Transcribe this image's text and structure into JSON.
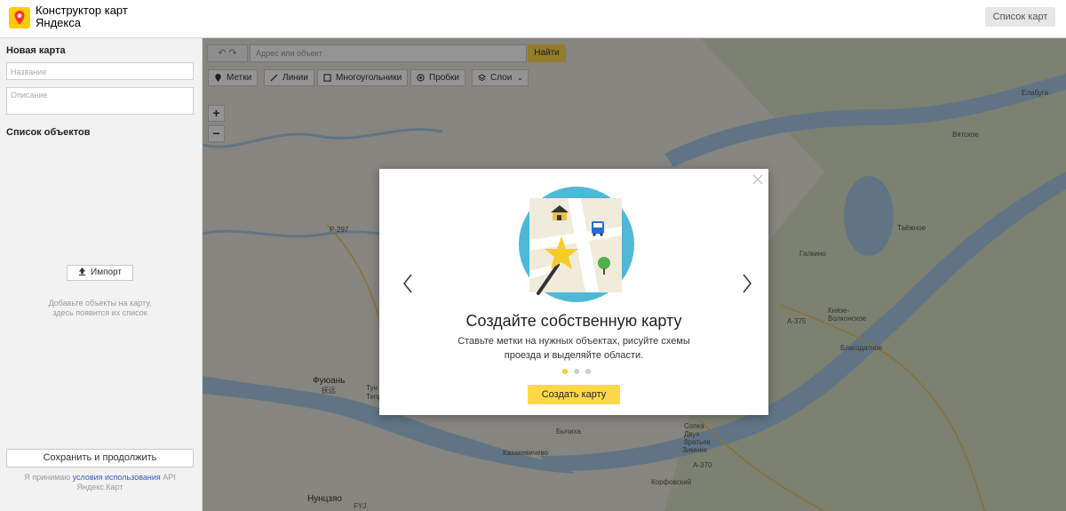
{
  "header": {
    "brand_line1": "Конструктор карт",
    "brand_line2": "Яндекса",
    "map_list_button": "Список карт"
  },
  "sidebar": {
    "title": "Новая карта",
    "name_placeholder": "Название",
    "description_placeholder": "Описание",
    "objects_title": "Список объектов",
    "import_button": "Импорт",
    "hint_line1": "Добавьте объекты на карту,",
    "hint_line2": "здесь появится их список",
    "save_button": "Сохранить и продолжить",
    "terms_prefix": "Я принимаю",
    "terms_link": "условия использования",
    "terms_suffix": "API",
    "terms_line2": "Яндекс.Карт"
  },
  "toolbar": {
    "address_placeholder": "Адрес или объект",
    "find_button": "Найти",
    "tools": [
      "Метки",
      "Линии",
      "Многоугольники",
      "Пробки",
      "Слои"
    ],
    "zoom_in": "+",
    "zoom_out": "−"
  },
  "map": {
    "labels": [
      "Фуюань",
      "抚远",
      "Нунцзяо",
      "Галкино",
      "Князе-Волконское",
      "Благодатное",
      "Таёжное",
      "Вятское",
      "Елабуга",
      "Корфовский",
      "Бычиха",
      "Казакевичево",
      "Сопка Двух братьев",
      "Зимнее",
      "P-297",
      "A-375",
      "A-370",
      "Тун",
      "Тепр",
      "FYJ"
    ]
  },
  "modal": {
    "title": "Создайте собственную карту",
    "text_line1": "Ставьте метки на нужных объектах, рисуйте схемы",
    "text_line2": "проезда и выделяйте области.",
    "create_button": "Создать карту",
    "pages_total": 3,
    "current_page": 1
  },
  "colors": {
    "accent": "#ffd84a",
    "dot_active": "#f6cc2a",
    "link": "#3a5db6",
    "illustration_circle": "#4fb8d6"
  }
}
